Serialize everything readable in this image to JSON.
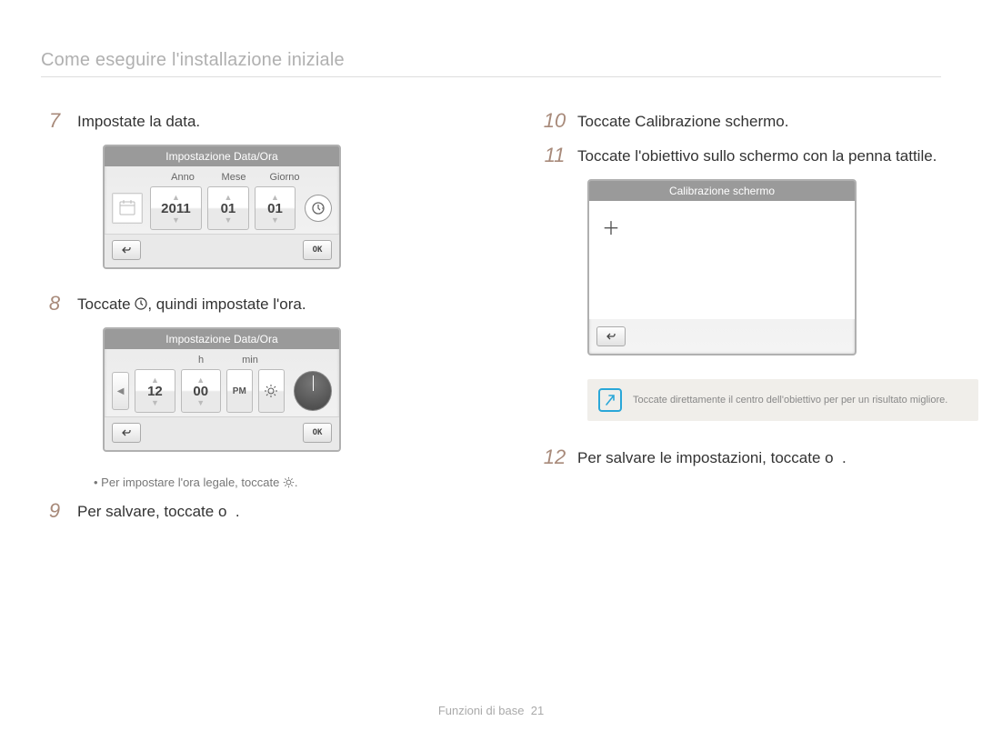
{
  "header": {
    "title": "Come eseguire l'installazione iniziale"
  },
  "left": {
    "step7": {
      "num": "7",
      "text": "Impostate la data."
    },
    "date_panel": {
      "title": "Impostazione Data/Ora",
      "labels": [
        "Anno",
        "Mese",
        "Giorno"
      ],
      "values": [
        "2011",
        "01",
        "01"
      ],
      "ok": "OK"
    },
    "step8": {
      "num": "8",
      "pre": "Toccate ",
      "post": ", quindi impostate l'ora."
    },
    "time_panel": {
      "title": "Impostazione Data/Ora",
      "labels": [
        "h",
        "min"
      ],
      "values": [
        "12",
        "00"
      ],
      "pm": "PM",
      "ok": "OK"
    },
    "dst_note": {
      "pre": "Per impostare l'ora legale, toccate ",
      "post": "."
    },
    "step9": {
      "num": "9",
      "pre": "Per salvare, toccate ",
      "ok": "o",
      "post": "."
    }
  },
  "right": {
    "step10": {
      "num": "10",
      "text": "Toccate Calibrazione schermo."
    },
    "step11": {
      "num": "11",
      "text": "Toccate l'obiettivo sullo schermo con la penna tattile."
    },
    "calib_panel": {
      "title": "Calibrazione schermo"
    },
    "note": "Toccate direttamente il centro dell'obiettivo per per un risultato migliore.",
    "step12": {
      "num": "12",
      "pre": "Per salvare le impostazioni, toccate ",
      "ok": "o",
      "post": "."
    }
  },
  "footer": {
    "label": "Funzioni di base",
    "page": "21"
  }
}
